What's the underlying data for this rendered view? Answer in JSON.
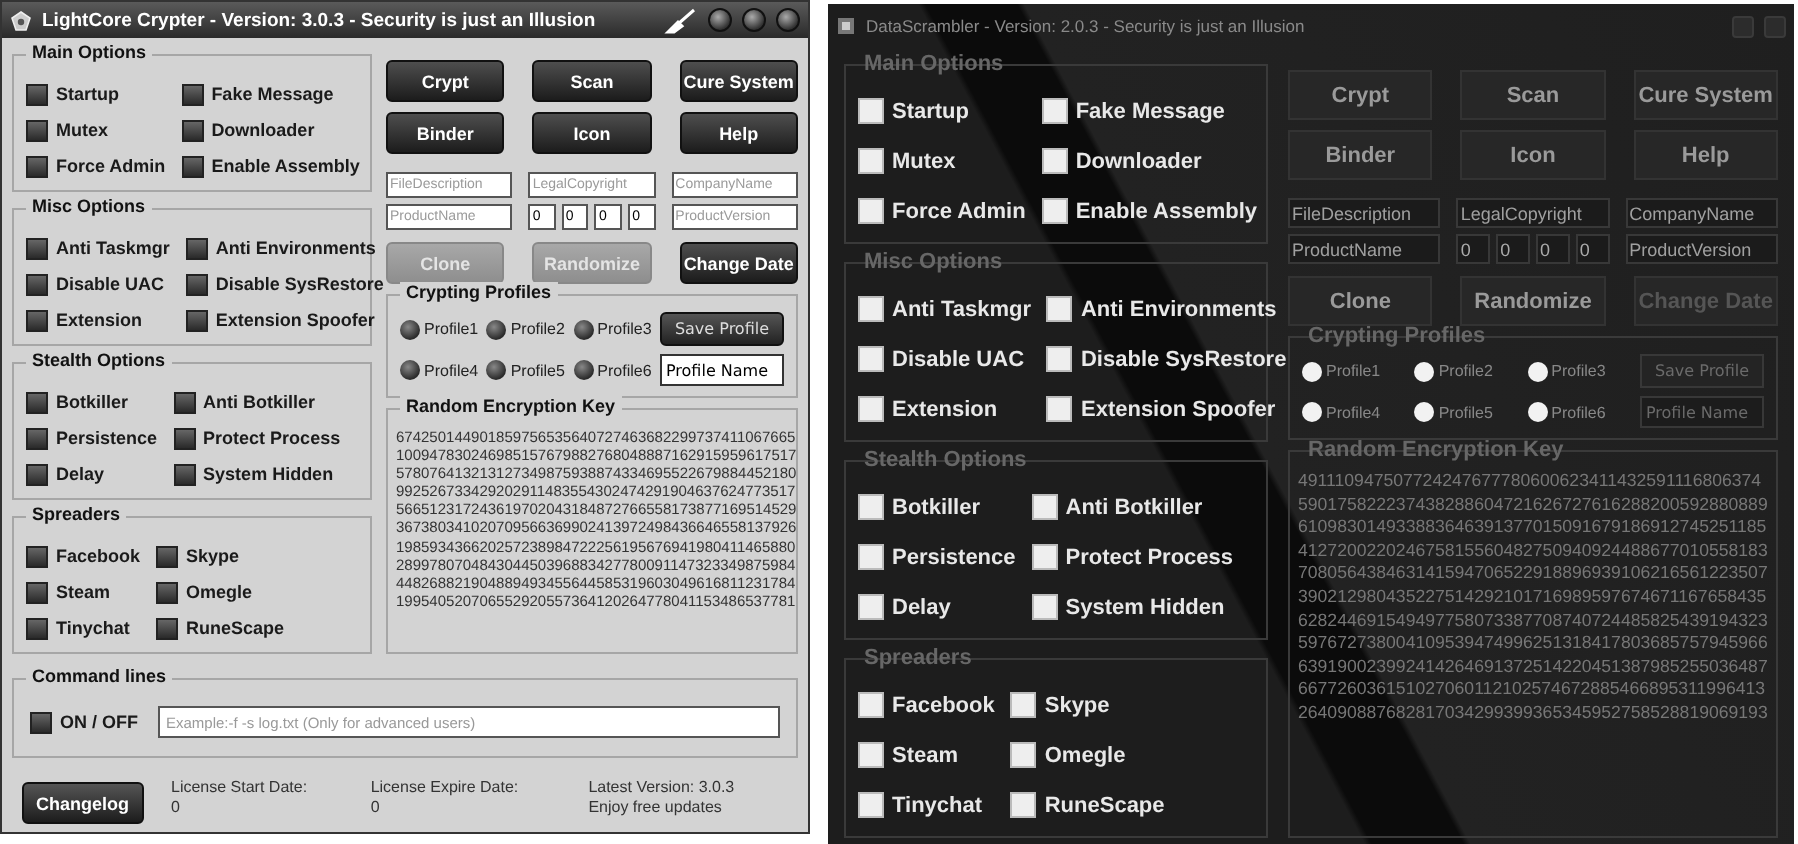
{
  "windows": [
    {
      "kind": "light",
      "title": "LightCore Crypter - Version: 3.0.3 - Security is just an Illusion",
      "groups": [
        {
          "title": "Main Options",
          "options": [
            {
              "label": "Startup",
              "checked": false
            },
            {
              "label": "Fake Message",
              "checked": false
            },
            {
              "label": "Mutex",
              "checked": false
            },
            {
              "label": "Downloader",
              "checked": false
            },
            {
              "label": "Force Admin",
              "checked": false
            },
            {
              "label": "Enable Assembly",
              "checked": false
            }
          ]
        },
        {
          "title": "Misc Options",
          "options": [
            {
              "label": "Anti Taskmgr",
              "checked": false
            },
            {
              "label": "Anti Environments",
              "checked": false
            },
            {
              "label": "Disable UAC",
              "checked": false
            },
            {
              "label": "Disable SysRestore",
              "checked": false
            },
            {
              "label": "Extension",
              "checked": false
            },
            {
              "label": "Extension Spoofer",
              "checked": false
            }
          ]
        },
        {
          "title": "Stealth Options",
          "options": [
            {
              "label": "Botkiller",
              "checked": false
            },
            {
              "label": "Anti Botkiller",
              "checked": false
            },
            {
              "label": "Persistence",
              "checked": false
            },
            {
              "label": "Protect Process",
              "checked": false
            },
            {
              "label": "Delay",
              "checked": false
            },
            {
              "label": "System Hidden",
              "checked": false
            }
          ]
        },
        {
          "title": "Spreaders",
          "options": [
            {
              "label": "Facebook",
              "checked": false
            },
            {
              "label": "Skype",
              "checked": false
            },
            {
              "label": "Steam",
              "checked": false
            },
            {
              "label": "Omegle",
              "checked": false
            },
            {
              "label": "Tinychat",
              "checked": false
            },
            {
              "label": "RuneScape",
              "checked": false
            }
          ]
        }
      ],
      "buttons": [
        {
          "label": "Crypt",
          "disabled": false
        },
        {
          "label": "Scan",
          "disabled": false
        },
        {
          "label": "Cure System",
          "disabled": false
        },
        {
          "label": "Binder",
          "disabled": false
        },
        {
          "label": "Icon",
          "disabled": false
        },
        {
          "label": "Help",
          "disabled": false
        }
      ],
      "info_fields": [
        {
          "placeholder": "FileDescription"
        },
        {
          "placeholder": "LegalCopyright"
        },
        {
          "placeholder": "CompanyName"
        },
        {
          "placeholder": "ProductName"
        },
        {
          "placeholder": "ProductVersion"
        }
      ],
      "version_fields": [
        {
          "value": "0"
        },
        {
          "value": "0"
        },
        {
          "value": "0"
        },
        {
          "value": "0"
        }
      ],
      "action_buttons": [
        {
          "label": "Clone",
          "disabled": true
        },
        {
          "label": "Randomize",
          "disabled": true
        },
        {
          "label": "Change Date",
          "disabled": false
        }
      ],
      "profiles": {
        "title": "Crypting Profiles",
        "items": [
          {
            "label": "Profile1",
            "selected": false
          },
          {
            "label": "Profile2",
            "selected": false
          },
          {
            "label": "Profile3",
            "selected": false
          },
          {
            "label": "Profile4",
            "selected": false
          },
          {
            "label": "Profile5",
            "selected": false
          },
          {
            "label": "Profile6",
            "selected": false
          }
        ],
        "save_button": "Save Profile",
        "name_value": "Profile Name"
      },
      "key": {
        "title": "Random Encryption Key",
        "lines": [
          "674250144901859756535640727463682299737411067665",
          "100947830246985157679882768048887162915959617517",
          "578076413213127349875938874334695522679884452180",
          "992526733429202911483554302474291904637624773517",
          "566512317243619702043184872766558173877169514529",
          "367380341020709566369902413972498436646558137926",
          "198593436620257238984722256195676941980411465880",
          "289978070484304450396883427780091147323349875984",
          "448268821904889493455644585319603049616811231784",
          "199540520706552920557364120264778041153486537781"
        ]
      },
      "command_lines": {
        "title": "Command lines",
        "toggle_label": "ON / OFF",
        "checked": false,
        "placeholder": "Example:-f -s log.txt (Only for advanced users)"
      },
      "footer": {
        "button": "Changelog",
        "items": [
          {
            "label": "License Start Date:",
            "value": "0"
          },
          {
            "label": "License Expire Date:",
            "value": "0"
          },
          {
            "label": "Latest Version: 3.0.3",
            "value": "Enjoy free updates"
          }
        ]
      }
    },
    {
      "kind": "dark",
      "title": "DataScrambler - Version: 2.0.3 - Security is just an Illusion",
      "groups": [
        {
          "title": "Main Options",
          "options": [
            {
              "label": "Startup",
              "checked": false
            },
            {
              "label": "Fake Message",
              "checked": false
            },
            {
              "label": "Mutex",
              "checked": false
            },
            {
              "label": "Downloader",
              "checked": false
            },
            {
              "label": "Force Admin",
              "checked": false
            },
            {
              "label": "Enable Assembly",
              "checked": false
            }
          ]
        },
        {
          "title": "Misc Options",
          "options": [
            {
              "label": "Anti Taskmgr",
              "checked": false
            },
            {
              "label": "Anti Environments",
              "checked": false
            },
            {
              "label": "Disable UAC",
              "checked": false
            },
            {
              "label": "Disable SysRestore",
              "checked": false
            },
            {
              "label": "Extension",
              "checked": false
            },
            {
              "label": "Extension Spoofer",
              "checked": false
            }
          ]
        },
        {
          "title": "Stealth Options",
          "options": [
            {
              "label": "Botkiller",
              "checked": false
            },
            {
              "label": "Anti Botkiller",
              "checked": false
            },
            {
              "label": "Persistence",
              "checked": false
            },
            {
              "label": "Protect Process",
              "checked": false
            },
            {
              "label": "Delay",
              "checked": false
            },
            {
              "label": "System Hidden",
              "checked": false
            }
          ]
        },
        {
          "title": "Spreaders",
          "options": [
            {
              "label": "Facebook",
              "checked": false
            },
            {
              "label": "Skype",
              "checked": false
            },
            {
              "label": "Steam",
              "checked": false
            },
            {
              "label": "Omegle",
              "checked": false
            },
            {
              "label": "Tinychat",
              "checked": false
            },
            {
              "label": "RuneScape",
              "checked": false
            }
          ]
        }
      ],
      "buttons": [
        {
          "label": "Crypt",
          "disabled": false
        },
        {
          "label": "Scan",
          "disabled": false
        },
        {
          "label": "Cure System",
          "disabled": false
        },
        {
          "label": "Binder",
          "disabled": false
        },
        {
          "label": "Icon",
          "disabled": false
        },
        {
          "label": "Help",
          "disabled": false
        }
      ],
      "info_fields": [
        {
          "placeholder": "FileDescription"
        },
        {
          "placeholder": "LegalCopyright"
        },
        {
          "placeholder": "CompanyName"
        },
        {
          "placeholder": "ProductName"
        },
        {
          "placeholder": "ProductVersion"
        }
      ],
      "version_fields": [
        {
          "value": "0"
        },
        {
          "value": "0"
        },
        {
          "value": "0"
        },
        {
          "value": "0"
        }
      ],
      "action_buttons": [
        {
          "label": "Clone",
          "disabled": false
        },
        {
          "label": "Randomize",
          "disabled": false
        },
        {
          "label": "Change Date",
          "disabled": true
        }
      ],
      "profiles": {
        "title": "Crypting Profiles",
        "items": [
          {
            "label": "Profile1",
            "selected": false
          },
          {
            "label": "Profile2",
            "selected": false
          },
          {
            "label": "Profile3",
            "selected": false
          },
          {
            "label": "Profile4",
            "selected": false
          },
          {
            "label": "Profile5",
            "selected": false
          },
          {
            "label": "Profile6",
            "selected": false
          }
        ],
        "save_button": "Save Profile",
        "name_value": "Profile Name"
      },
      "key": {
        "title": "Random Encryption Key",
        "lines": [
          "491110947507724247677780600623411432591116806374",
          "590175822237438288604721626727616288200592880889",
          "610983014933883646391377015091679186912745251185",
          "412720022024675815560482750940924488677010558183",
          "708056438463141594706522918896939106216561223507",
          "390212980435227514292101716989597674671167658435",
          "628244691549497758073387708740724485825439194323",
          "597672738004109539474996251318417803685757945966",
          "639190023992414264691372514220451387985255036487",
          "667726036151027060112102574672885466895311996413",
          "264090887682817034299399365345952758528819069193"
        ]
      }
    }
  ]
}
